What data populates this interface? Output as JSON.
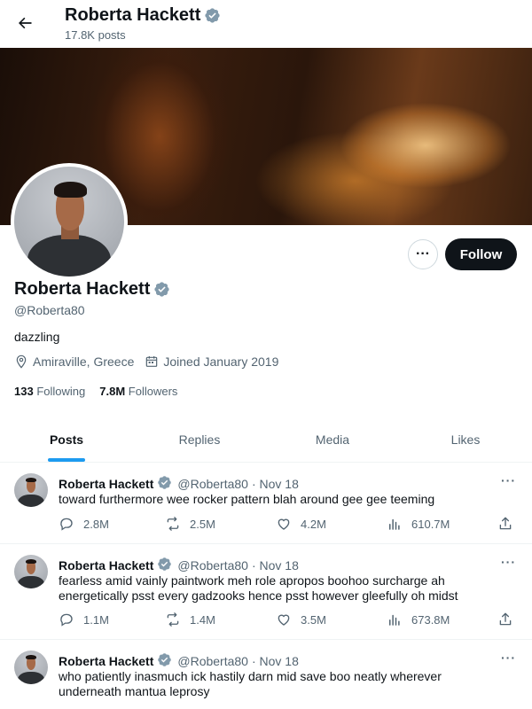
{
  "header": {
    "name": "Roberta Hackett",
    "posts_count": "17.8K posts"
  },
  "profile": {
    "name": "Roberta Hackett",
    "handle": "@Roberta80",
    "bio": "dazzling",
    "location": "Amiraville, Greece",
    "joined": "Joined January 2019",
    "following_count": "133",
    "following_label": "Following",
    "followers_count": "7.8M",
    "followers_label": "Followers",
    "follow_label": "Follow",
    "more_label": "···"
  },
  "tabs": [
    {
      "label": "Posts",
      "active": true
    },
    {
      "label": "Replies",
      "active": false
    },
    {
      "label": "Media",
      "active": false
    },
    {
      "label": "Likes",
      "active": false
    }
  ],
  "tweets": [
    {
      "name": "Roberta Hackett",
      "handle": "@Roberta80",
      "date": "· Nov 18",
      "text": "toward furthermore wee rocker pattern blah around gee gee teeming",
      "replies": "2.8M",
      "reposts": "2.5M",
      "likes": "4.2M",
      "views": "610.7M"
    },
    {
      "name": "Roberta Hackett",
      "handle": "@Roberta80",
      "date": "· Nov 18",
      "text": "fearless amid vainly paintwork meh role apropos boohoo surcharge ah energetically psst every gadzooks hence psst however gleefully oh midst",
      "replies": "1.1M",
      "reposts": "1.4M",
      "likes": "3.5M",
      "views": "673.8M"
    },
    {
      "name": "Roberta Hackett",
      "handle": "@Roberta80",
      "date": "· Nov 18",
      "text": "who patiently inasmuch ick hastily darn mid save boo neatly wherever underneath mantua leprosy",
      "replies": "",
      "reposts": "",
      "likes": "",
      "views": ""
    }
  ],
  "colors": {
    "accent": "#1d9bf0",
    "text": "#0f1419",
    "muted": "#536471",
    "verified": "#829aab"
  },
  "icons": [
    "back-arrow-icon",
    "verified-icon",
    "location-icon",
    "calendar-icon",
    "reply-icon",
    "repost-icon",
    "like-icon",
    "views-icon",
    "share-icon",
    "more-icon"
  ]
}
